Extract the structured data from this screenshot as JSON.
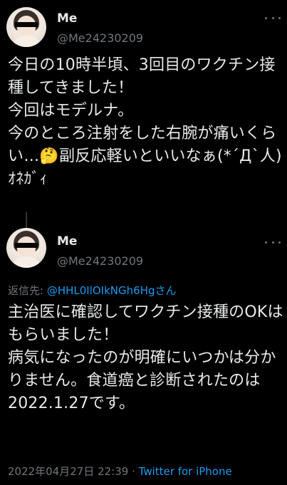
{
  "tweets": [
    {
      "name": "Me",
      "handle": "@Me24230209",
      "text": "今日の10時半頃、3回目のワクチン接種してきました！\n今回はモデルナ。\n今のところ注射をした右腕が痛いくらい…🤔副反応軽いといいなぁ(*´Д`人)ｵﾈｶﾞｨ"
    },
    {
      "name": "Me",
      "handle": "@Me24230209",
      "reply_prefix": "返信先: ",
      "reply_mention": "@HHL0IlOIkNGh6Hgさん",
      "text": "主治医に確認してワクチン接種のOKはもらいました！\n病気になったのが明確にいつかは分かりません。食道癌と診断されたのは2022.1.27です。",
      "timestamp": "2022年04月27日 22:39",
      "separator": " · ",
      "source": "Twitter for iPhone"
    }
  ],
  "colors": {
    "background": "#000000",
    "text": "#e7e9ea",
    "secondary": "#71767b",
    "accent": "#1d9bf0"
  },
  "icons": [
    "more-options-icon"
  ]
}
